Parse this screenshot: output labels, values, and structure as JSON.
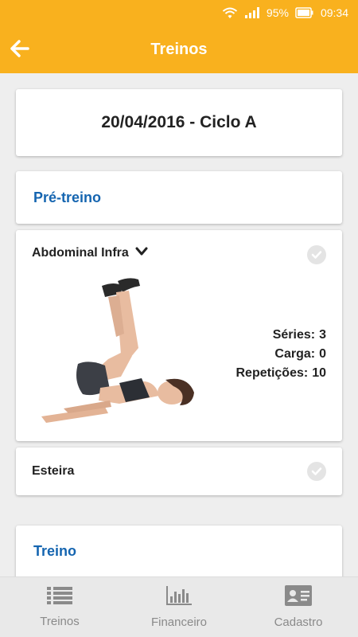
{
  "status_bar": {
    "battery": "95%",
    "time": "09:34"
  },
  "app_bar": {
    "title": "Treinos"
  },
  "date_header": "20/04/2016 - Ciclo A",
  "sections": {
    "pre_treino": "Pré-treino",
    "treino": "Treino"
  },
  "exercise": {
    "name": "Abdominal Infra",
    "stats": [
      {
        "label": "Séries:",
        "value": "3"
      },
      {
        "label": "Carga:",
        "value": "0"
      },
      {
        "label": "Repetições:",
        "value": "10"
      }
    ]
  },
  "exercise2": {
    "name": "Esteira"
  },
  "bottom_nav": [
    {
      "label": "Treinos",
      "icon": "list-icon"
    },
    {
      "label": "Financeiro",
      "icon": "bar-chart-icon"
    },
    {
      "label": "Cadastro",
      "icon": "id-card-icon"
    }
  ],
  "colors": {
    "accent": "#f9b11e",
    "section_title": "#1565b0"
  }
}
